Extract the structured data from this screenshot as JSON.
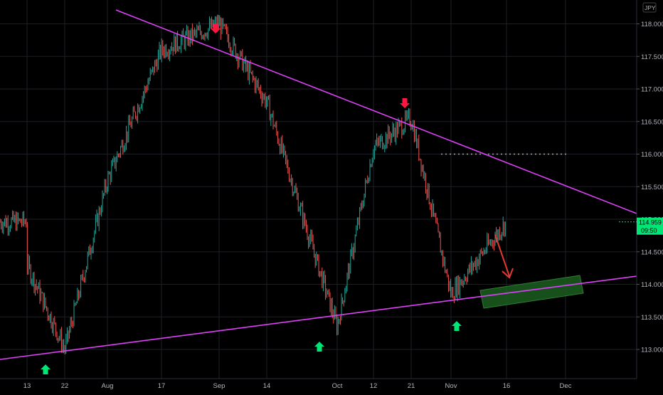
{
  "chart_data": {
    "type": "candlestick",
    "instrument": {
      "currency_label": "JPY"
    },
    "price_label": {
      "value": "114.959",
      "countdown": "09:50"
    },
    "y_axis": {
      "ylim": [
        112.9,
        118.35
      ],
      "ticks": [
        "113.000",
        "113.500",
        "114.000",
        "114.500",
        "115.000",
        "115.500",
        "116.000",
        "116.500",
        "117.000",
        "117.500",
        "118.000"
      ]
    },
    "x_axis": {
      "ticks": [
        "13",
        "22",
        "Aug",
        "17",
        "Sep",
        "14",
        "Oct",
        "12",
        "21",
        "Nov",
        "16",
        "Dec"
      ]
    },
    "grid": true,
    "price_path": [
      [
        "13",
        114.3
      ],
      [
        "22",
        113.0
      ],
      [
        "Aug",
        115.6
      ],
      [
        "17",
        117.6
      ],
      [
        "Sep",
        118.0
      ],
      [
        "14",
        116.8
      ],
      [
        "Oct",
        113.35
      ],
      [
        "12",
        116.1
      ],
      [
        "21",
        116.55
      ],
      [
        "Nov",
        113.85
      ],
      [
        "16",
        114.96
      ]
    ],
    "annotations": {
      "resistance_line": {
        "color": "#e040fb"
      },
      "support_line": {
        "color": "#e040fb"
      },
      "support_zone": {
        "color": "#1b5e20"
      },
      "dotted_level": {
        "value": 116.0,
        "color": "#aaaaaa"
      },
      "projection_arrow": {
        "color": "#e53935"
      },
      "down_markers": {
        "count": 2,
        "color": "#ff1744"
      },
      "up_markers": {
        "count": 3,
        "color": "#00e676"
      }
    },
    "colors": {
      "background": "#000000",
      "up_candle": "#26a69a",
      "down_candle": "#ef5350",
      "price_badge": "#00e676",
      "axis_text": "#b2b5be",
      "grid": "#1c1f26"
    }
  }
}
